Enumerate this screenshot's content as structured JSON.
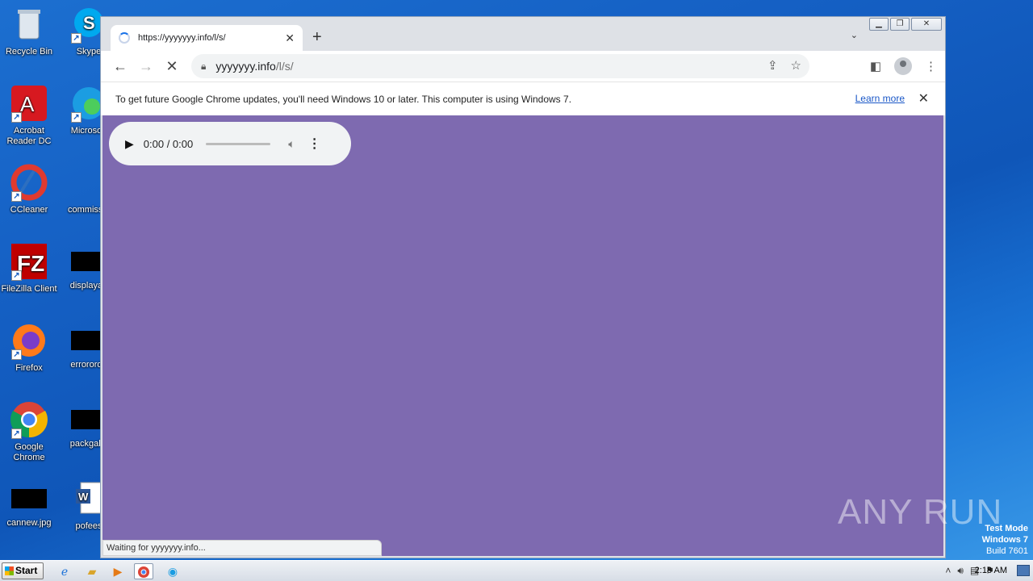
{
  "desktop": {
    "icons": [
      {
        "label": "Recycle Bin",
        "icon": "recycle-bin-icon"
      },
      {
        "label": "Skype",
        "icon": "skype-icon"
      },
      {
        "label": "Acrobat Reader DC",
        "icon": "acrobat-reader-icon"
      },
      {
        "label": "Microsoft",
        "icon": "microsoft-edge-icon"
      },
      {
        "label": "CCleaner",
        "icon": "ccleaner-icon"
      },
      {
        "label": "commissio",
        "icon": "document-icon"
      },
      {
        "label": "FileZilla Client",
        "icon": "filezilla-icon"
      },
      {
        "label": "displayau",
        "icon": "image-icon"
      },
      {
        "label": "Firefox",
        "icon": "firefox-icon"
      },
      {
        "label": "errororde",
        "icon": "image-icon"
      },
      {
        "label": "Google Chrome",
        "icon": "chrome-icon"
      },
      {
        "label": "packgalle",
        "icon": "image-icon"
      },
      {
        "label": "cannew.jpg",
        "icon": "image-icon"
      },
      {
        "label": "pofees",
        "icon": "word-document-icon"
      }
    ]
  },
  "browser": {
    "tab": {
      "title": "https://yyyyyyy.info/l/s/"
    },
    "address": {
      "host": "yyyyyyy.info",
      "path": "/l/s/"
    },
    "infobar": {
      "message": "To get future Google Chrome updates, you'll need Windows 10 or later. This computer is using Windows 7.",
      "link": "Learn more"
    },
    "audio": {
      "time": "0:00 / 0:00"
    },
    "status": "Waiting for yyyyyyy.info..."
  },
  "watermark": "ANY  RUN",
  "testmode": {
    "line1": "Test Mode",
    "line2": "Windows 7",
    "line3": "Build 7601"
  },
  "taskbar": {
    "start": "Start",
    "clock": "2:18 AM"
  }
}
